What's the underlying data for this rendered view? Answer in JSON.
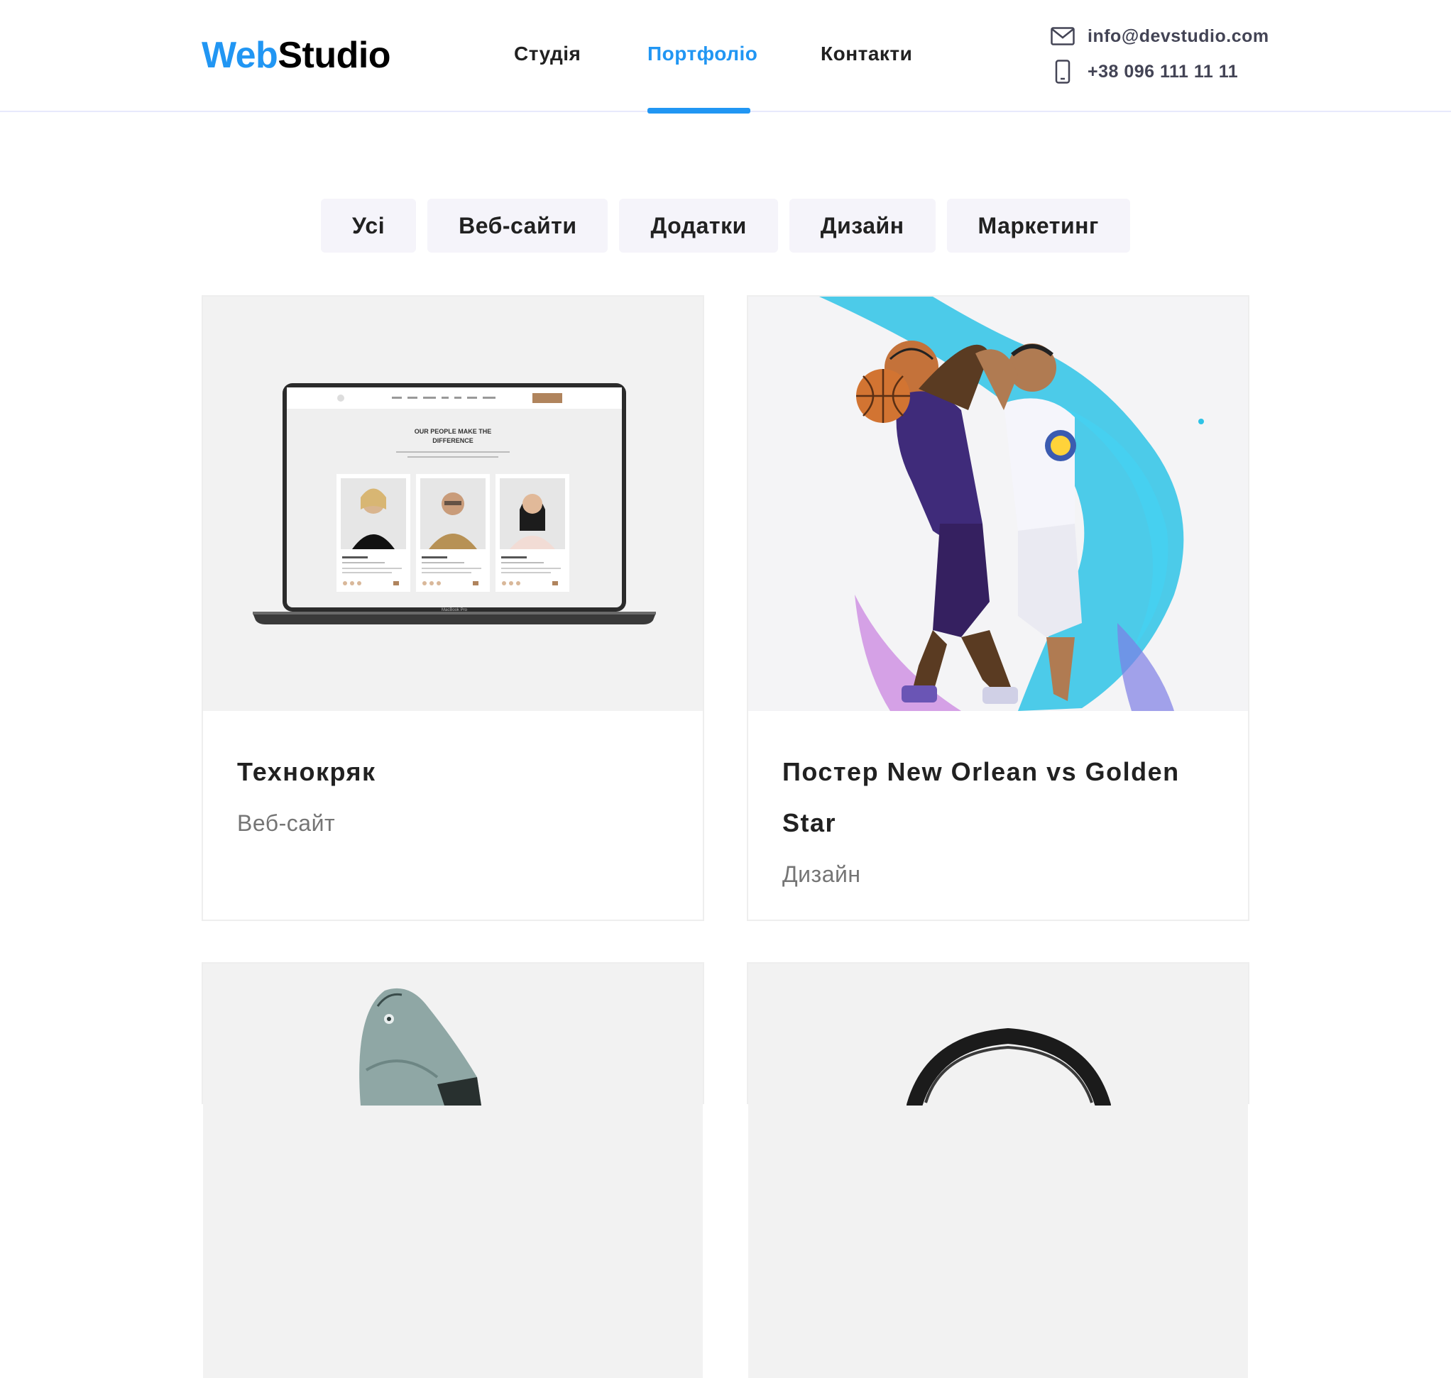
{
  "brand": {
    "part1": "Web",
    "part2": "Studio"
  },
  "nav": {
    "items": [
      {
        "label": "Студія"
      },
      {
        "label": "Портфоліо",
        "active": true
      },
      {
        "label": "Контакти"
      }
    ]
  },
  "contacts": {
    "email": "info@devstudio.com",
    "phone": "+38 096 111 11 11"
  },
  "filters": [
    "Усі",
    "Веб-сайти",
    "Додатки",
    "Дизайн",
    "Маркетинг"
  ],
  "portfolio": [
    {
      "title": "Технокряк",
      "category": "Веб-сайт",
      "image": "laptop-mockup"
    },
    {
      "title": "Постер New Orlean vs Golden Star",
      "category": "Дизайн",
      "image": "basketball-poster"
    },
    {
      "title": "",
      "category": "",
      "image": "fish-illustration"
    },
    {
      "title": "",
      "category": "",
      "image": "headphones"
    }
  ],
  "mockup": {
    "heading_line1": "OUR PEOPLE MAKE THE",
    "heading_line2": "DIFFERENCE",
    "brand": "MacBook Pro"
  },
  "colors": {
    "accent": "#2196f3",
    "text": "#212121",
    "muted": "#757575",
    "filter_bg": "#f5f4fa"
  }
}
